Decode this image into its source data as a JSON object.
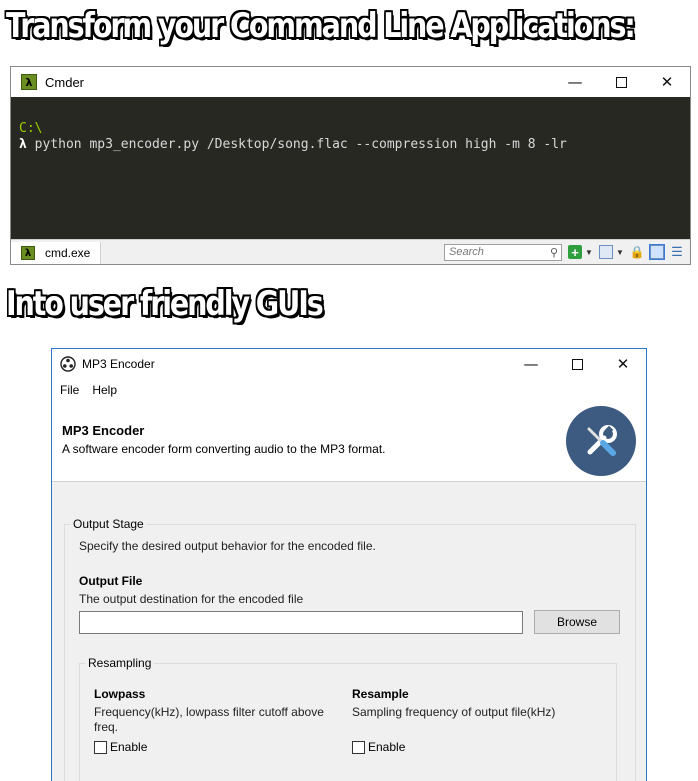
{
  "headlines": {
    "top": "Transform your Command Line Applications:",
    "bottom": "Into user friendly GUIs"
  },
  "cmder": {
    "title": "Cmder",
    "console_path": "C:\\",
    "console_prompt": "λ",
    "console_command": " python mp3_encoder.py /Desktop/song.flac --compression high -m 8 -lr",
    "tab_label": "cmd.exe",
    "search_placeholder": "Search"
  },
  "encoder": {
    "title": "MP3 Encoder",
    "menu": [
      "File",
      "Help"
    ],
    "header_title": "MP3 Encoder",
    "header_subtitle": "A software encoder form converting audio to the MP3 format.",
    "output_stage": {
      "legend": "Output Stage",
      "description": "Specify the desired output behavior for the encoded file.",
      "output_file_label": "Output File",
      "output_file_help": "The output destination for the encoded file",
      "output_file_value": "",
      "browse_label": "Browse"
    },
    "resampling": {
      "legend": "Resampling",
      "lowpass_label": "Lowpass",
      "lowpass_help": "Frequency(kHz), lowpass filter cutoff above freq.",
      "lowpass_checkbox": "Enable",
      "resample_label": "Resample",
      "resample_help": "Sampling frequency of output file(kHz)",
      "resample_checkbox": "Enable"
    }
  },
  "colors": {
    "console_bg": "#272822",
    "path_green": "#9bd000",
    "header_icon_bg": "#3d5a80",
    "window_border": "#2b78c5"
  }
}
